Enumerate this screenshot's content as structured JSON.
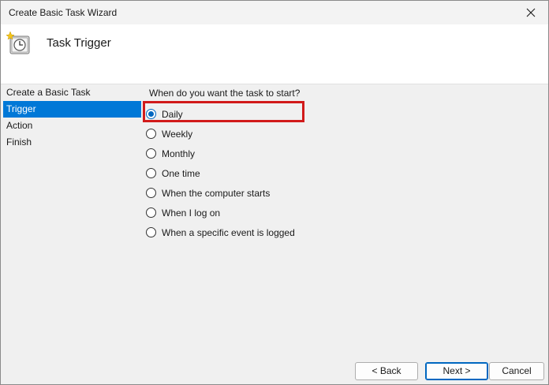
{
  "window": {
    "title": "Create Basic Task Wizard"
  },
  "header": {
    "title": "Task Trigger",
    "icon": "clock-icon"
  },
  "nav": {
    "items": [
      {
        "label": "Create a Basic Task",
        "selected": false
      },
      {
        "label": "Trigger",
        "selected": true
      },
      {
        "label": "Action",
        "selected": false
      },
      {
        "label": "Finish",
        "selected": false
      }
    ]
  },
  "main": {
    "question": "When do you want the task to start?",
    "options": [
      {
        "label": "Daily",
        "checked": true
      },
      {
        "label": "Weekly",
        "checked": false
      },
      {
        "label": "Monthly",
        "checked": false
      },
      {
        "label": "One time",
        "checked": false
      },
      {
        "label": "When the computer starts",
        "checked": false
      },
      {
        "label": "When I log on",
        "checked": false
      },
      {
        "label": "When a specific event is logged",
        "checked": false
      }
    ]
  },
  "buttons": {
    "back": "< Back",
    "next": "Next >",
    "cancel": "Cancel"
  },
  "colors": {
    "selection": "#0078d7",
    "highlight": "#d11a1a",
    "radio": "#0067c0"
  }
}
